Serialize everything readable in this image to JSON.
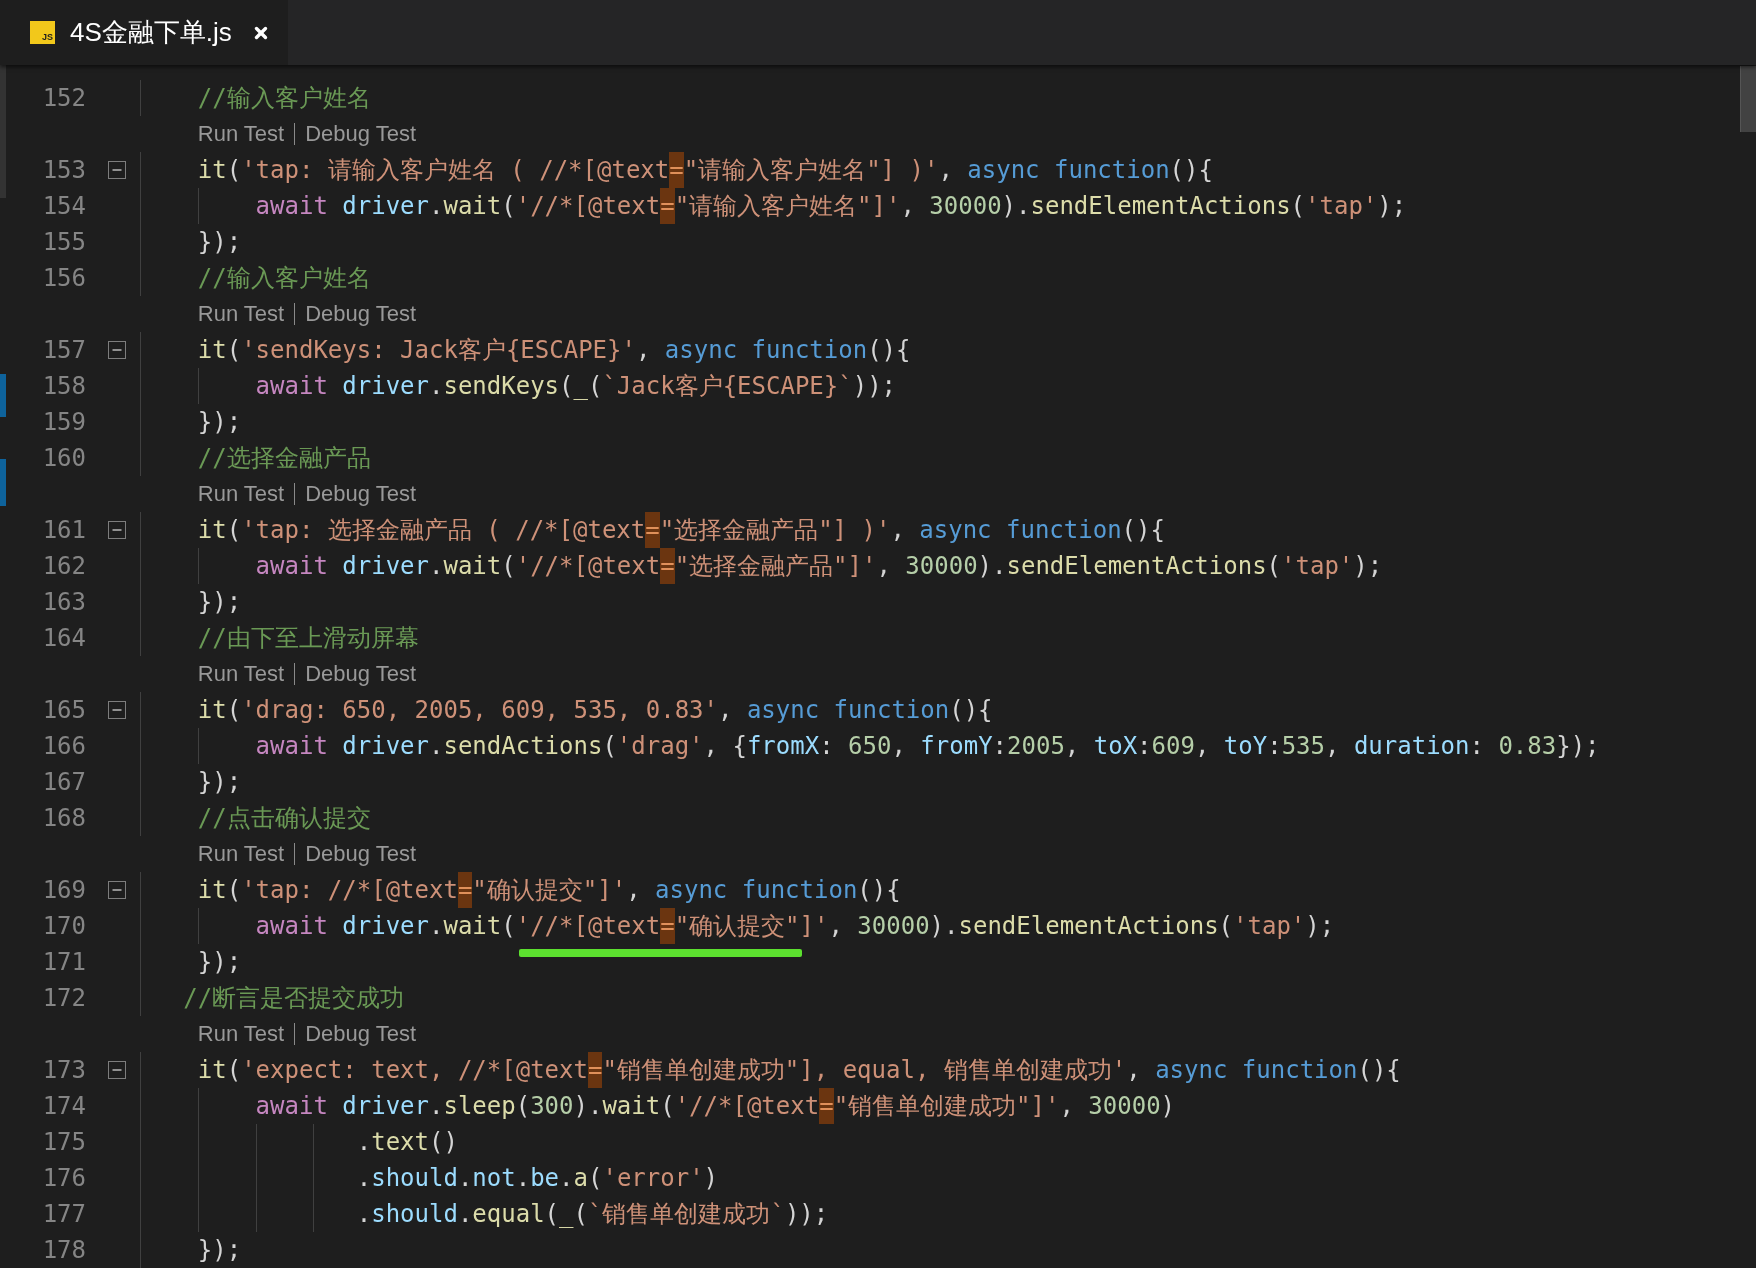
{
  "tabs": [
    {
      "label": "4S金融下单.js",
      "icon_text": "JS",
      "selected": true
    }
  ],
  "editor": {
    "lines": [
      {
        "kind": "code",
        "number": "152",
        "tokens": [
          {
            "kind": "comment",
            "text": "    //输入客户姓名"
          }
        ]
      },
      {
        "kind": "codelens",
        "links": [
          "Run Test",
          "Debug Test"
        ]
      },
      {
        "kind": "code",
        "number": "153",
        "fold": {
          "expanded": true
        },
        "tokens": [
          {
            "kind": "function",
            "text": "    it"
          },
          {
            "kind": "plain",
            "text": "("
          },
          {
            "kind": "string",
            "text": "'tap: 请输入客户姓名 ( //*[@text"
          },
          {
            "kind": "match",
            "text": "="
          },
          {
            "kind": "string",
            "text": "\"请输入客户姓名\"] )'"
          },
          {
            "kind": "plain",
            "text": ", "
          },
          {
            "kind": "keyword",
            "text": "async function"
          },
          {
            "kind": "plain",
            "text": "(){"
          }
        ]
      },
      {
        "kind": "code",
        "number": "154",
        "tokens": [
          {
            "kind": "control",
            "text": "        await "
          },
          {
            "kind": "variable",
            "text": "driver"
          },
          {
            "kind": "plain",
            "text": "."
          },
          {
            "kind": "function",
            "text": "wait"
          },
          {
            "kind": "plain",
            "text": "("
          },
          {
            "kind": "string",
            "text": "'//*[@text"
          },
          {
            "kind": "match",
            "text": "="
          },
          {
            "kind": "string",
            "text": "\"请输入客户姓名\"]'"
          },
          {
            "kind": "plain",
            "text": ", "
          },
          {
            "kind": "number",
            "text": "30000"
          },
          {
            "kind": "plain",
            "text": ")."
          },
          {
            "kind": "function",
            "text": "sendElementActions"
          },
          {
            "kind": "plain",
            "text": "("
          },
          {
            "kind": "string",
            "text": "'tap'"
          },
          {
            "kind": "plain",
            "text": ");"
          }
        ]
      },
      {
        "kind": "code",
        "number": "155",
        "tokens": [
          {
            "kind": "plain",
            "text": "    });"
          }
        ]
      },
      {
        "kind": "code",
        "number": "156",
        "tokens": [
          {
            "kind": "comment",
            "text": "    //输入客户姓名"
          }
        ]
      },
      {
        "kind": "codelens",
        "links": [
          "Run Test",
          "Debug Test"
        ]
      },
      {
        "kind": "code",
        "number": "157",
        "fold": {
          "expanded": true
        },
        "tokens": [
          {
            "kind": "function",
            "text": "    it"
          },
          {
            "kind": "plain",
            "text": "("
          },
          {
            "kind": "string",
            "text": "'sendKeys: Jack客户{ESCAPE}'"
          },
          {
            "kind": "plain",
            "text": ", "
          },
          {
            "kind": "keyword",
            "text": "async function"
          },
          {
            "kind": "plain",
            "text": "(){"
          }
        ]
      },
      {
        "kind": "code",
        "number": "158",
        "tokens": [
          {
            "kind": "control",
            "text": "        await "
          },
          {
            "kind": "variable",
            "text": "driver"
          },
          {
            "kind": "plain",
            "text": "."
          },
          {
            "kind": "function",
            "text": "sendKeys"
          },
          {
            "kind": "plain",
            "text": "("
          },
          {
            "kind": "function",
            "text": "_"
          },
          {
            "kind": "plain",
            "text": "("
          },
          {
            "kind": "string",
            "text": "`Jack客户{ESCAPE}`"
          },
          {
            "kind": "plain",
            "text": "));"
          }
        ]
      },
      {
        "kind": "code",
        "number": "159",
        "tokens": [
          {
            "kind": "plain",
            "text": "    });"
          }
        ]
      },
      {
        "kind": "code",
        "number": "160",
        "tokens": [
          {
            "kind": "comment",
            "text": "    //选择金融产品"
          }
        ]
      },
      {
        "kind": "codelens",
        "links": [
          "Run Test",
          "Debug Test"
        ]
      },
      {
        "kind": "code",
        "number": "161",
        "fold": {
          "expanded": true
        },
        "tokens": [
          {
            "kind": "function",
            "text": "    it"
          },
          {
            "kind": "plain",
            "text": "("
          },
          {
            "kind": "string",
            "text": "'tap: 选择金融产品 ( //*[@text"
          },
          {
            "kind": "match",
            "text": "="
          },
          {
            "kind": "string",
            "text": "\"选择金融产品\"] )'"
          },
          {
            "kind": "plain",
            "text": ", "
          },
          {
            "kind": "keyword",
            "text": "async function"
          },
          {
            "kind": "plain",
            "text": "(){"
          }
        ]
      },
      {
        "kind": "code",
        "number": "162",
        "tokens": [
          {
            "kind": "control",
            "text": "        await "
          },
          {
            "kind": "variable",
            "text": "driver"
          },
          {
            "kind": "plain",
            "text": "."
          },
          {
            "kind": "function",
            "text": "wait"
          },
          {
            "kind": "plain",
            "text": "("
          },
          {
            "kind": "string",
            "text": "'//*[@text"
          },
          {
            "kind": "match",
            "text": "="
          },
          {
            "kind": "string",
            "text": "\"选择金融产品\"]'"
          },
          {
            "kind": "plain",
            "text": ", "
          },
          {
            "kind": "number",
            "text": "30000"
          },
          {
            "kind": "plain",
            "text": ")."
          },
          {
            "kind": "function",
            "text": "sendElementActions"
          },
          {
            "kind": "plain",
            "text": "("
          },
          {
            "kind": "string",
            "text": "'tap'"
          },
          {
            "kind": "plain",
            "text": ");"
          }
        ]
      },
      {
        "kind": "code",
        "number": "163",
        "tokens": [
          {
            "kind": "plain",
            "text": "    });"
          }
        ]
      },
      {
        "kind": "code",
        "number": "164",
        "tokens": [
          {
            "kind": "comment",
            "text": "    //由下至上滑动屏幕"
          }
        ]
      },
      {
        "kind": "codelens",
        "links": [
          "Run Test",
          "Debug Test"
        ]
      },
      {
        "kind": "code",
        "number": "165",
        "fold": {
          "expanded": true
        },
        "tokens": [
          {
            "kind": "function",
            "text": "    it"
          },
          {
            "kind": "plain",
            "text": "("
          },
          {
            "kind": "string",
            "text": "'drag: 650, 2005, 609, 535, 0.83'"
          },
          {
            "kind": "plain",
            "text": ", "
          },
          {
            "kind": "keyword",
            "text": "async function"
          },
          {
            "kind": "plain",
            "text": "(){"
          }
        ]
      },
      {
        "kind": "code",
        "number": "166",
        "tokens": [
          {
            "kind": "control",
            "text": "        await "
          },
          {
            "kind": "variable",
            "text": "driver"
          },
          {
            "kind": "plain",
            "text": "."
          },
          {
            "kind": "function",
            "text": "sendActions"
          },
          {
            "kind": "plain",
            "text": "("
          },
          {
            "kind": "string",
            "text": "'drag'"
          },
          {
            "kind": "plain",
            "text": ", {"
          },
          {
            "kind": "variable",
            "text": "fromX"
          },
          {
            "kind": "plain",
            "text": ": "
          },
          {
            "kind": "number",
            "text": "650"
          },
          {
            "kind": "plain",
            "text": ", "
          },
          {
            "kind": "variable",
            "text": "fromY"
          },
          {
            "kind": "plain",
            "text": ":"
          },
          {
            "kind": "number",
            "text": "2005"
          },
          {
            "kind": "plain",
            "text": ", "
          },
          {
            "kind": "variable",
            "text": "toX"
          },
          {
            "kind": "plain",
            "text": ":"
          },
          {
            "kind": "number",
            "text": "609"
          },
          {
            "kind": "plain",
            "text": ", "
          },
          {
            "kind": "variable",
            "text": "toY"
          },
          {
            "kind": "plain",
            "text": ":"
          },
          {
            "kind": "number",
            "text": "535"
          },
          {
            "kind": "plain",
            "text": ", "
          },
          {
            "kind": "variable",
            "text": "duration"
          },
          {
            "kind": "plain",
            "text": ": "
          },
          {
            "kind": "number",
            "text": "0.83"
          },
          {
            "kind": "plain",
            "text": "});"
          }
        ]
      },
      {
        "kind": "code",
        "number": "167",
        "tokens": [
          {
            "kind": "plain",
            "text": "    });"
          }
        ]
      },
      {
        "kind": "code",
        "number": "168",
        "tokens": [
          {
            "kind": "comment",
            "text": "    //点击确认提交"
          }
        ]
      },
      {
        "kind": "codelens",
        "links": [
          "Run Test",
          "Debug Test"
        ]
      },
      {
        "kind": "code",
        "number": "169",
        "fold": {
          "expanded": true
        },
        "tokens": [
          {
            "kind": "function",
            "text": "    it"
          },
          {
            "kind": "plain",
            "text": "("
          },
          {
            "kind": "string",
            "text": "'tap: //*[@text"
          },
          {
            "kind": "match",
            "text": "="
          },
          {
            "kind": "string",
            "text": "\"确认提交\"]'"
          },
          {
            "kind": "plain",
            "text": ", "
          },
          {
            "kind": "keyword",
            "text": "async function"
          },
          {
            "kind": "plain",
            "text": "(){"
          }
        ]
      },
      {
        "kind": "code",
        "number": "170",
        "tokens": [
          {
            "kind": "control",
            "text": "        await "
          },
          {
            "kind": "variable",
            "text": "driver"
          },
          {
            "kind": "plain",
            "text": "."
          },
          {
            "kind": "function",
            "text": "wait"
          },
          {
            "kind": "plain",
            "text": "("
          },
          {
            "kind": "mark",
            "tokens": [
              {
                "kind": "string",
                "text": "'//*[@text"
              },
              {
                "kind": "match",
                "text": "="
              },
              {
                "kind": "string",
                "text": "\"确认提交\"]'"
              }
            ]
          },
          {
            "kind": "plain",
            "text": ", "
          },
          {
            "kind": "number",
            "text": "30000"
          },
          {
            "kind": "plain",
            "text": ")."
          },
          {
            "kind": "function",
            "text": "sendElementActions"
          },
          {
            "kind": "plain",
            "text": "("
          },
          {
            "kind": "string",
            "text": "'tap'"
          },
          {
            "kind": "plain",
            "text": ");"
          }
        ]
      },
      {
        "kind": "code",
        "number": "171",
        "tokens": [
          {
            "kind": "plain",
            "text": "    });"
          }
        ]
      },
      {
        "kind": "code",
        "number": "172",
        "tokens": [
          {
            "kind": "comment",
            "text": "   //断言是否提交成功"
          }
        ]
      },
      {
        "kind": "codelens",
        "links": [
          "Run Test",
          "Debug Test"
        ]
      },
      {
        "kind": "code",
        "number": "173",
        "fold": {
          "expanded": true
        },
        "tokens": [
          {
            "kind": "function",
            "text": "    it"
          },
          {
            "kind": "plain",
            "text": "("
          },
          {
            "kind": "string",
            "text": "'expect: text, //*[@text"
          },
          {
            "kind": "match",
            "text": "="
          },
          {
            "kind": "string",
            "text": "\"销售单创建成功\"], equal, 销售单创建成功'"
          },
          {
            "kind": "plain",
            "text": ", "
          },
          {
            "kind": "keyword",
            "text": "async function"
          },
          {
            "kind": "plain",
            "text": "(){"
          }
        ]
      },
      {
        "kind": "code",
        "number": "174",
        "tokens": [
          {
            "kind": "control",
            "text": "        await "
          },
          {
            "kind": "variable",
            "text": "driver"
          },
          {
            "kind": "plain",
            "text": "."
          },
          {
            "kind": "function",
            "text": "sleep"
          },
          {
            "kind": "plain",
            "text": "("
          },
          {
            "kind": "number",
            "text": "300"
          },
          {
            "kind": "plain",
            "text": ")."
          },
          {
            "kind": "function",
            "text": "wait"
          },
          {
            "kind": "plain",
            "text": "("
          },
          {
            "kind": "string",
            "text": "'//*[@text"
          },
          {
            "kind": "match",
            "text": "="
          },
          {
            "kind": "string",
            "text": "\"销售单创建成功\"]'"
          },
          {
            "kind": "plain",
            "text": ", "
          },
          {
            "kind": "number",
            "text": "30000"
          },
          {
            "kind": "plain",
            "text": ")"
          }
        ]
      },
      {
        "kind": "code",
        "number": "175",
        "tokens": [
          {
            "kind": "plain",
            "text": "               ."
          },
          {
            "kind": "function",
            "text": "text"
          },
          {
            "kind": "plain",
            "text": "()"
          }
        ]
      },
      {
        "kind": "code",
        "number": "176",
        "tokens": [
          {
            "kind": "plain",
            "text": "               ."
          },
          {
            "kind": "variable",
            "text": "should"
          },
          {
            "kind": "plain",
            "text": "."
          },
          {
            "kind": "variable",
            "text": "not"
          },
          {
            "kind": "plain",
            "text": "."
          },
          {
            "kind": "variable",
            "text": "be"
          },
          {
            "kind": "plain",
            "text": "."
          },
          {
            "kind": "function",
            "text": "a"
          },
          {
            "kind": "plain",
            "text": "("
          },
          {
            "kind": "string",
            "text": "'error'"
          },
          {
            "kind": "plain",
            "text": ")"
          }
        ]
      },
      {
        "kind": "code",
        "number": "177",
        "tokens": [
          {
            "kind": "plain",
            "text": "               ."
          },
          {
            "kind": "variable",
            "text": "should"
          },
          {
            "kind": "plain",
            "text": "."
          },
          {
            "kind": "function",
            "text": "equal"
          },
          {
            "kind": "plain",
            "text": "("
          },
          {
            "kind": "function",
            "text": "_"
          },
          {
            "kind": "plain",
            "text": "("
          },
          {
            "kind": "string",
            "text": "`销售单创建成功`"
          },
          {
            "kind": "plain",
            "text": "));"
          }
        ]
      },
      {
        "kind": "code",
        "number": "178",
        "tokens": [
          {
            "kind": "plain",
            "text": "    });"
          }
        ]
      }
    ]
  }
}
